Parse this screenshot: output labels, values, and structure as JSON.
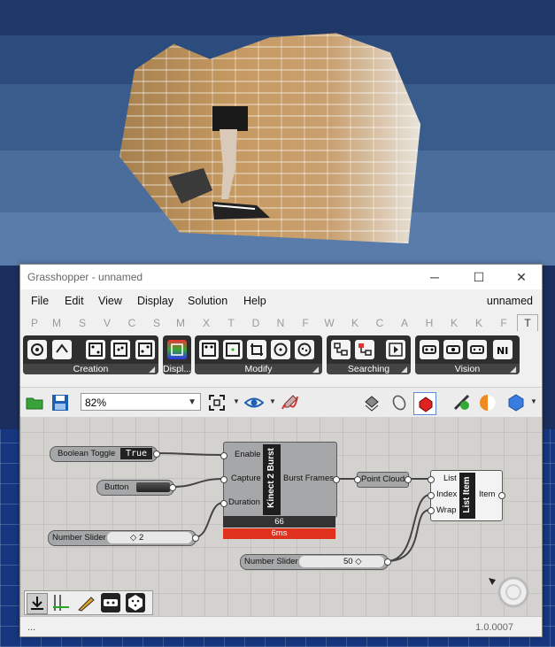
{
  "window": {
    "title": "Grasshopper - unnamed",
    "minimize": "─",
    "maximize": "☐",
    "close": "✕"
  },
  "menu": {
    "items": [
      "File",
      "Edit",
      "View",
      "Display",
      "Solution",
      "Help"
    ],
    "document": "unnamed"
  },
  "tabs": [
    "P",
    "M",
    "S",
    "V",
    "C",
    "S",
    "M",
    "X",
    "T",
    "D",
    "N",
    "F",
    "W",
    "K",
    "C",
    "A",
    "H",
    "K",
    "K",
    "F",
    "T"
  ],
  "ribbon": {
    "panels": [
      "Creation",
      "Displ...",
      "Modify",
      "Searching",
      "Vision"
    ]
  },
  "toolbar": {
    "zoom": "82%"
  },
  "components": {
    "boolean_toggle": {
      "label": "Boolean Toggle",
      "value": "True"
    },
    "button": {
      "label": "Button"
    },
    "slider1": {
      "label": "Number Slider",
      "value": "◇ 2"
    },
    "slider2": {
      "label": "Number Slider",
      "value": "50 ◇"
    },
    "kinect": {
      "title": "Kinect 2 Burst",
      "inputs": [
        "Enable",
        "Capture",
        "Duration"
      ],
      "output": "Burst Frames",
      "count": "66",
      "time": "6ms"
    },
    "point_cloud": {
      "label": "Point Cloud"
    },
    "list_item": {
      "title": "List Item",
      "inputs": [
        "List",
        "Index",
        "Wrap"
      ],
      "output": "Item"
    }
  },
  "status": {
    "left": "...",
    "version": "1.0.0007"
  },
  "colors": {
    "accent_red": "#e0301e",
    "canvas": "#d4d2cf",
    "component": "#a6a7a8",
    "panel": "#2e2e2e"
  }
}
